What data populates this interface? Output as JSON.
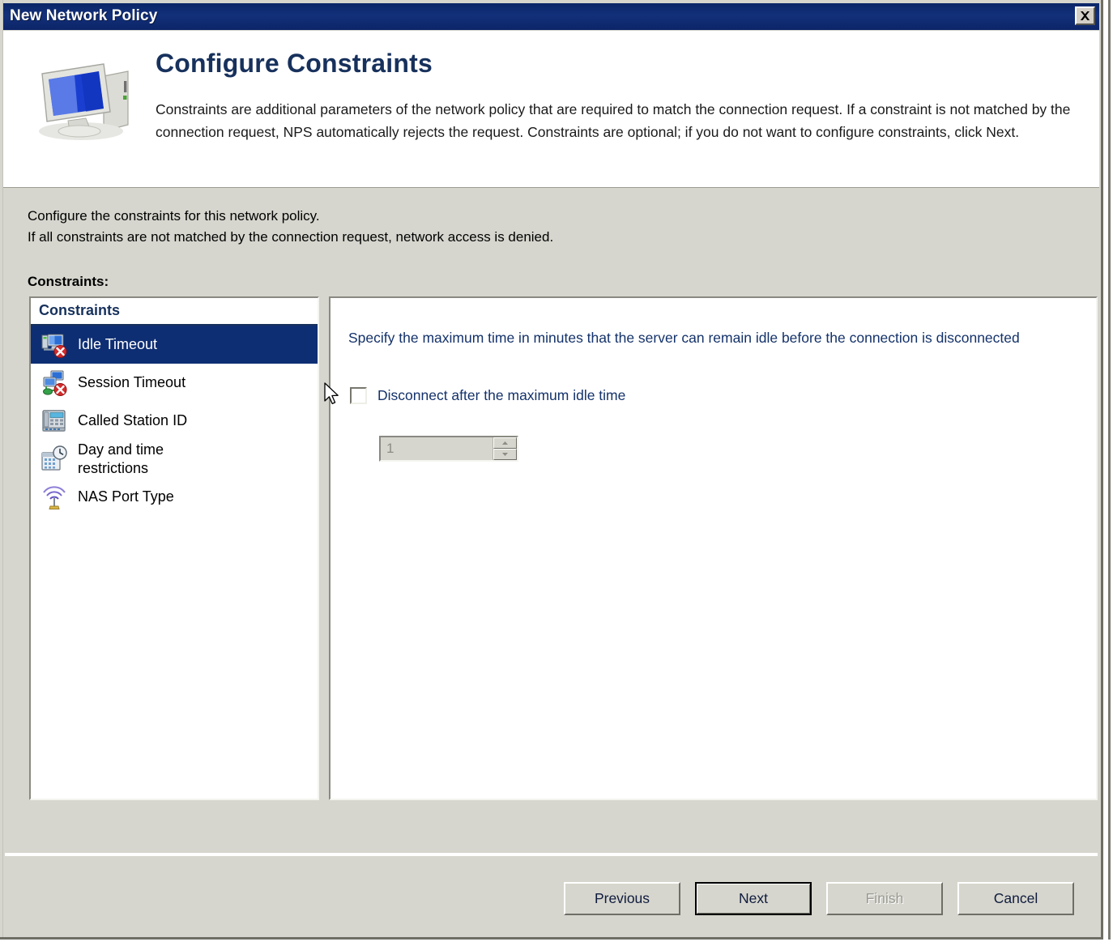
{
  "window": {
    "title": "New Network Policy",
    "close_icon": "close-icon"
  },
  "header": {
    "icon": "computer-monitor-icon",
    "title": "Configure Constraints",
    "description": "Constraints are additional parameters of the network policy that are required to match the connection request. If a constraint is not matched by the connection request, NPS automatically rejects the request. Constraints are optional; if you do not want to configure constraints, click Next."
  },
  "body": {
    "intro_line1": "Configure the constraints for this network policy.",
    "intro_line2": "If all constraints are not matched by the connection request, network access is denied.",
    "constraints_label": "Constraints:"
  },
  "list": {
    "header": "Constraints",
    "selected_index": 0,
    "items": [
      {
        "label": "Idle Timeout",
        "icon": "computer-timeout-icon",
        "selected": true
      },
      {
        "label": "Session Timeout",
        "icon": "network-timeout-icon",
        "selected": false
      },
      {
        "label": "Called Station ID",
        "icon": "telephone-icon",
        "selected": false
      },
      {
        "label": "Day and time\nrestrictions",
        "icon": "calendar-clock-icon",
        "selected": false
      },
      {
        "label": "NAS Port Type",
        "icon": "wireless-antenna-icon",
        "selected": false
      }
    ]
  },
  "detail": {
    "description": "Specify the maximum time in minutes that the server can remain idle before the connection is disconnected",
    "checkbox_label": "Disconnect after the maximum idle time",
    "checkbox_checked": false,
    "spinner_value": "1",
    "spinner_enabled": false
  },
  "footer": {
    "buttons": [
      {
        "label": "Previous",
        "state": "enabled"
      },
      {
        "label": "Next",
        "state": "default"
      },
      {
        "label": "Finish",
        "state": "disabled"
      },
      {
        "label": "Cancel",
        "state": "enabled"
      }
    ]
  },
  "colors": {
    "titlebar": "#0d2568",
    "dialog_face": "#d6d6ce",
    "selection": "#0e2e73",
    "heading_blue": "#17315c",
    "text_blue": "#14326a"
  }
}
